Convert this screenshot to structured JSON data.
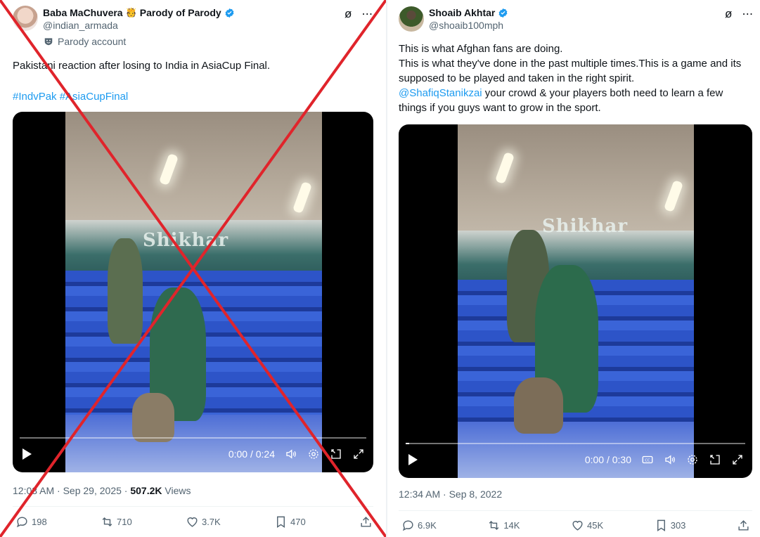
{
  "left_post": {
    "author_name": "Baba MaChuvera",
    "author_suffix": "Parody of Parody",
    "author_emoji": "🫅",
    "handle": "@indian_armada",
    "parody_label": "Parody account",
    "text": "Pakistani reaction after losing to India in AsiaCup Final.",
    "hashtags": "#IndvPak #AsiaCupFinal",
    "video": {
      "time": "0:00 / 0:24",
      "progress": 0.0,
      "banner_text": "Shikhar"
    },
    "timestamp": "12:03 AM · Sep 29, 2025 · ",
    "views_count": "507.2K",
    "views_label": " Views",
    "stats": {
      "replies": "198",
      "reposts": "710",
      "likes": "3.7K",
      "bookmarks": "470"
    }
  },
  "right_post": {
    "author_name": "Shoaib Akhtar",
    "handle": "@shoaib100mph",
    "lines": [
      "This is what Afghan fans are doing.",
      "This is what they've done in the past multiple times.This is a game and its",
      "supposed to be played and taken in the right spirit."
    ],
    "mention": "@ShafiqStanikzai",
    "mention_rest": " your crowd & your players both need to learn a few",
    "last_line": "things if you guys want to grow in the sport.",
    "video": {
      "time": "0:00 / 0:30",
      "progress": 0.01,
      "banner_text": "Shikhar"
    },
    "timestamp": "12:34 AM · Sep 8, 2022",
    "stats": {
      "replies": "6.9K",
      "reposts": "14K",
      "likes": "45K",
      "bookmarks": "303"
    }
  },
  "colors": {
    "link": "#1d9bf0",
    "verified": "#1d9bf0",
    "cross": "#e0242b",
    "muted": "#536471"
  },
  "icons": [
    "grok-icon",
    "more-icon",
    "verified-icon",
    "parody-icon",
    "play-icon",
    "cc-icon",
    "volume-icon",
    "settings-icon",
    "pip-icon",
    "fullscreen-icon",
    "reply-icon",
    "repost-icon",
    "like-icon",
    "bookmark-icon",
    "share-icon"
  ]
}
